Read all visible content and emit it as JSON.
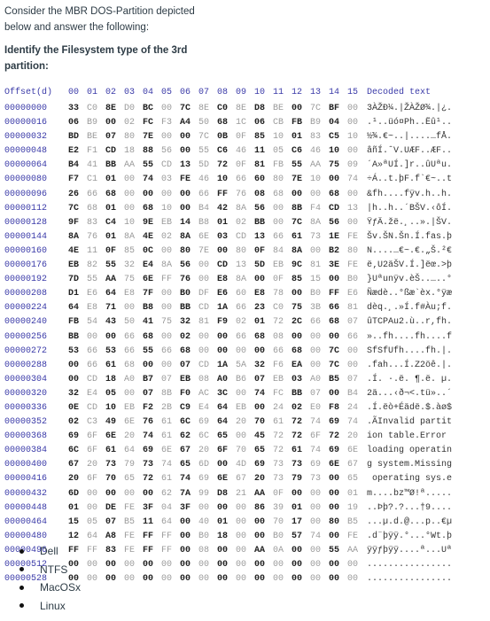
{
  "intro": "Consider the MBR DOS-Partition depicted below and answer the following:",
  "question": "Identify the Filesystem type of the 3rd partition:",
  "hexdump": {
    "header": {
      "offset_label": "Offset(d)",
      "columns": [
        "00",
        "01",
        "02",
        "03",
        "04",
        "05",
        "06",
        "07",
        "08",
        "09",
        "10",
        "11",
        "12",
        "13",
        "14",
        "15"
      ],
      "decoded_label": "Decoded text"
    },
    "rows": [
      {
        "offset": "00000000",
        "bytes": [
          "33",
          "C0",
          "8E",
          "D0",
          "BC",
          "00",
          "7C",
          "8E",
          "C0",
          "8E",
          "D8",
          "BE",
          "00",
          "7C",
          "BF",
          "00"
        ],
        "decoded": "3ÀŽĐ¼.|ŽÀŽØ¾.|¿."
      },
      {
        "offset": "00000016",
        "bytes": [
          "06",
          "B9",
          "00",
          "02",
          "FC",
          "F3",
          "A4",
          "50",
          "68",
          "1C",
          "06",
          "CB",
          "FB",
          "B9",
          "04",
          "00"
        ],
        "decoded": ".¹..üó¤Ph..Ëû¹.."
      },
      {
        "offset": "00000032",
        "bytes": [
          "BD",
          "BE",
          "07",
          "80",
          "7E",
          "00",
          "00",
          "7C",
          "0B",
          "0F",
          "85",
          "10",
          "01",
          "83",
          "C5",
          "10"
        ],
        "decoded": "½¾.€~..|....…fÅ."
      },
      {
        "offset": "00000048",
        "bytes": [
          "E2",
          "F1",
          "CD",
          "18",
          "88",
          "56",
          "00",
          "55",
          "C6",
          "46",
          "11",
          "05",
          "C6",
          "46",
          "10",
          "00"
        ],
        "decoded": "âñÍ.ˆV.UÆF..ÆF.."
      },
      {
        "offset": "00000064",
        "bytes": [
          "B4",
          "41",
          "BB",
          "AA",
          "55",
          "CD",
          "13",
          "5D",
          "72",
          "0F",
          "81",
          "FB",
          "55",
          "AA",
          "75",
          "09"
        ],
        "decoded": "´A»ªUÍ.]r..ûUªu."
      },
      {
        "offset": "00000080",
        "bytes": [
          "F7",
          "C1",
          "01",
          "00",
          "74",
          "03",
          "FE",
          "46",
          "10",
          "66",
          "60",
          "80",
          "7E",
          "10",
          "00",
          "74"
        ],
        "decoded": "÷Á..t.þF.f`€~..t"
      },
      {
        "offset": "00000096",
        "bytes": [
          "26",
          "66",
          "68",
          "00",
          "00",
          "00",
          "00",
          "66",
          "FF",
          "76",
          "08",
          "68",
          "00",
          "00",
          "68",
          "00"
        ],
        "decoded": "&fh....fÿv.h..h."
      },
      {
        "offset": "00000112",
        "bytes": [
          "7C",
          "68",
          "01",
          "00",
          "68",
          "10",
          "00",
          "B4",
          "42",
          "8A",
          "56",
          "00",
          "8B",
          "F4",
          "CD",
          "13"
        ],
        "decoded": "|h..h..´BŠV.‹ôÍ."
      },
      {
        "offset": "00000128",
        "bytes": [
          "9F",
          "83",
          "C4",
          "10",
          "9E",
          "EB",
          "14",
          "B8",
          "01",
          "02",
          "BB",
          "00",
          "7C",
          "8A",
          "56",
          "00"
        ],
        "decoded": "ŸƒÄ.žë.¸..».|ŠV."
      },
      {
        "offset": "00000144",
        "bytes": [
          "8A",
          "76",
          "01",
          "8A",
          "4E",
          "02",
          "8A",
          "6E",
          "03",
          "CD",
          "13",
          "66",
          "61",
          "73",
          "1E",
          "FE"
        ],
        "decoded": "Šv.ŠN.Šn.Í.fas.þ"
      },
      {
        "offset": "00000160",
        "bytes": [
          "4E",
          "11",
          "0F",
          "85",
          "0C",
          "00",
          "80",
          "7E",
          "00",
          "80",
          "0F",
          "84",
          "8A",
          "00",
          "B2",
          "80"
        ],
        "decoded": "N....…€~.€.„Š.²€"
      },
      {
        "offset": "00000176",
        "bytes": [
          "EB",
          "82",
          "55",
          "32",
          "E4",
          "8A",
          "56",
          "00",
          "CD",
          "13",
          "5D",
          "EB",
          "9C",
          "81",
          "3E",
          "FE"
        ],
        "decoded": "ë‚U2äŠV.Í.]ëœ.>þ"
      },
      {
        "offset": "00000192",
        "bytes": [
          "7D",
          "55",
          "AA",
          "75",
          "6E",
          "FF",
          "76",
          "00",
          "E8",
          "8A",
          "00",
          "0F",
          "85",
          "15",
          "00",
          "B0"
        ],
        "decoded": "}Uªunÿv.èŠ..…..°"
      },
      {
        "offset": "00000208",
        "bytes": [
          "D1",
          "E6",
          "64",
          "E8",
          "7F",
          "00",
          "B0",
          "DF",
          "E6",
          "60",
          "E8",
          "78",
          "00",
          "B0",
          "FF",
          "E6"
        ],
        "decoded": "Ñædè..°ßæ`èx.°ÿæ"
      },
      {
        "offset": "00000224",
        "bytes": [
          "64",
          "E8",
          "71",
          "00",
          "B8",
          "00",
          "BB",
          "CD",
          "1A",
          "66",
          "23",
          "C0",
          "75",
          "3B",
          "66",
          "81"
        ],
        "decoded": "dèq.¸.»Í.f#Àu;f."
      },
      {
        "offset": "00000240",
        "bytes": [
          "FB",
          "54",
          "43",
          "50",
          "41",
          "75",
          "32",
          "81",
          "F9",
          "02",
          "01",
          "72",
          "2C",
          "66",
          "68",
          "07"
        ],
        "decoded": "ûTCPAu2.ù..r,fh."
      },
      {
        "offset": "00000256",
        "bytes": [
          "BB",
          "00",
          "00",
          "66",
          "68",
          "00",
          "02",
          "00",
          "00",
          "66",
          "68",
          "08",
          "00",
          "00",
          "00",
          "66"
        ],
        "decoded": "»..fh....fh....f"
      },
      {
        "offset": "00000272",
        "bytes": [
          "53",
          "66",
          "53",
          "66",
          "55",
          "66",
          "68",
          "00",
          "00",
          "00",
          "00",
          "66",
          "68",
          "00",
          "7C",
          "00"
        ],
        "decoded": "SfSfUfh....fh.|."
      },
      {
        "offset": "00000288",
        "bytes": [
          "00",
          "66",
          "61",
          "68",
          "00",
          "00",
          "07",
          "CD",
          "1A",
          "5A",
          "32",
          "F6",
          "EA",
          "00",
          "7C",
          "00"
        ],
        "decoded": ".fah...Í.Z2öê.|."
      },
      {
        "offset": "00000304",
        "bytes": [
          "00",
          "CD",
          "18",
          "A0",
          "B7",
          "07",
          "EB",
          "08",
          "A0",
          "B6",
          "07",
          "EB",
          "03",
          "A0",
          "B5",
          "07"
        ],
        "decoded": ".Í. ·.ë. ¶.ë. µ."
      },
      {
        "offset": "00000320",
        "bytes": [
          "32",
          "E4",
          "05",
          "00",
          "07",
          "8B",
          "F0",
          "AC",
          "3C",
          "00",
          "74",
          "FC",
          "BB",
          "07",
          "00",
          "B4"
        ],
        "decoded": "2ä...‹ð¬<.tü»..´"
      },
      {
        "offset": "00000336",
        "bytes": [
          "0E",
          "CD",
          "10",
          "EB",
          "F2",
          "2B",
          "C9",
          "E4",
          "64",
          "EB",
          "00",
          "24",
          "02",
          "E0",
          "F8",
          "24"
        ],
        "decoded": ".Í.ëò+Éädë.$.àø$"
      },
      {
        "offset": "00000352",
        "bytes": [
          "02",
          "C3",
          "49",
          "6E",
          "76",
          "61",
          "6C",
          "69",
          "64",
          "20",
          "70",
          "61",
          "72",
          "74",
          "69",
          "74"
        ],
        "decoded": ".ÃInvalid partit"
      },
      {
        "offset": "00000368",
        "bytes": [
          "69",
          "6F",
          "6E",
          "20",
          "74",
          "61",
          "62",
          "6C",
          "65",
          "00",
          "45",
          "72",
          "72",
          "6F",
          "72",
          "20"
        ],
        "decoded": "ion table.Error "
      },
      {
        "offset": "00000384",
        "bytes": [
          "6C",
          "6F",
          "61",
          "64",
          "69",
          "6E",
          "67",
          "20",
          "6F",
          "70",
          "65",
          "72",
          "61",
          "74",
          "69",
          "6E"
        ],
        "decoded": "loading operatin"
      },
      {
        "offset": "00000400",
        "bytes": [
          "67",
          "20",
          "73",
          "79",
          "73",
          "74",
          "65",
          "6D",
          "00",
          "4D",
          "69",
          "73",
          "73",
          "69",
          "6E",
          "67"
        ],
        "decoded": "g system.Missing"
      },
      {
        "offset": "00000416",
        "bytes": [
          "20",
          "6F",
          "70",
          "65",
          "72",
          "61",
          "74",
          "69",
          "6E",
          "67",
          "20",
          "73",
          "79",
          "73",
          "00",
          "65"
        ],
        "decoded": " operating sys.e"
      },
      {
        "offset": "00000432",
        "bytes": [
          "6D",
          "00",
          "00",
          "00",
          "00",
          "62",
          "7A",
          "99",
          "D8",
          "21",
          "AA",
          "0F",
          "00",
          "00",
          "00",
          "01"
        ],
        "decoded": "m....bz™Ø!ª....."
      },
      {
        "offset": "00000448",
        "bytes": [
          "01",
          "00",
          "DE",
          "FE",
          "3F",
          "04",
          "3F",
          "00",
          "00",
          "00",
          "86",
          "39",
          "01",
          "00",
          "00",
          "19"
        ],
        "decoded": "..Þþ?.?...†9...."
      },
      {
        "offset": "00000464",
        "bytes": [
          "15",
          "05",
          "07",
          "B5",
          "11",
          "64",
          "00",
          "40",
          "01",
          "00",
          "00",
          "70",
          "17",
          "00",
          "80",
          "B5"
        ],
        "decoded": "...µ.d.@...p..€µ"
      },
      {
        "offset": "00000480",
        "bytes": [
          "12",
          "64",
          "A8",
          "FE",
          "FF",
          "FF",
          "00",
          "B0",
          "18",
          "00",
          "00",
          "B0",
          "57",
          "74",
          "00",
          "FE"
        ],
        "decoded": ".d¨þÿÿ.°...°Wt.þ"
      },
      {
        "offset": "00000496",
        "bytes": [
          "FF",
          "FF",
          "83",
          "FE",
          "FF",
          "FF",
          "00",
          "08",
          "00",
          "00",
          "AA",
          "0A",
          "00",
          "00",
          "55",
          "AA"
        ],
        "decoded": "ÿÿƒþÿÿ....ª...Uª"
      },
      {
        "offset": "00000512",
        "bytes": [
          "00",
          "00",
          "00",
          "00",
          "00",
          "00",
          "00",
          "00",
          "00",
          "00",
          "00",
          "00",
          "00",
          "00",
          "00",
          "00"
        ],
        "decoded": "................"
      },
      {
        "offset": "00000528",
        "bytes": [
          "00",
          "00",
          "00",
          "00",
          "00",
          "00",
          "00",
          "00",
          "00",
          "00",
          "00",
          "00",
          "00",
          "00",
          "00",
          "00"
        ],
        "decoded": "................"
      }
    ]
  },
  "options": [
    "Dell",
    "NTFS",
    "MacOSx",
    "Linux"
  ]
}
